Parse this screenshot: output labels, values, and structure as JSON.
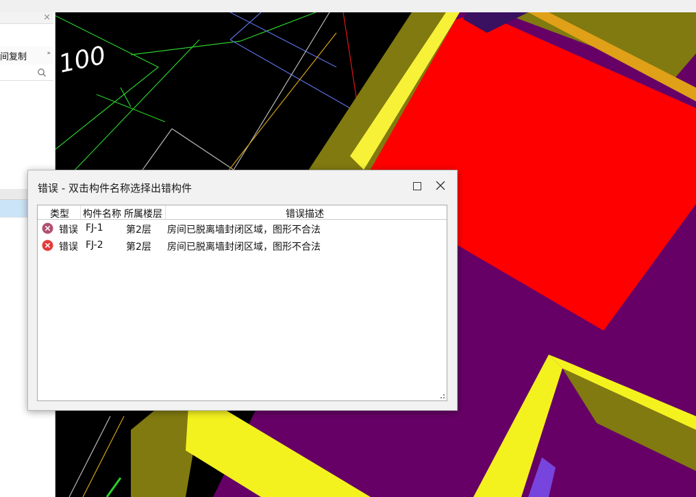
{
  "left_panel": {
    "toolbar_label": "间复制",
    "more_glyph": "»"
  },
  "dialog": {
    "title": "错误 - 双击构件名称选择出错构件",
    "columns": [
      "类型",
      "构件名称",
      "所属楼层",
      "错误描述"
    ],
    "rows": [
      {
        "type": "错误",
        "name": "FJ-1",
        "floor": "第2层",
        "desc": "房间已脱离墙封闭区域，图形不合法",
        "icon": "error-icon-muted"
      },
      {
        "type": "错误",
        "name": "FJ-2",
        "floor": "第2层",
        "desc": "房间已脱离墙封闭区域，图形不合法",
        "icon": "error-icon"
      }
    ]
  },
  "viewport": {
    "dimension_labels": [
      "100",
      "00"
    ],
    "colors": {
      "room_fill": "#ff0000",
      "floor_slab": "#660066",
      "wall_top": "#f3f21f",
      "wall_side": "#807a10",
      "canvas": "#000000"
    }
  },
  "colors": {
    "error_active": "#e43a3a",
    "error_muted": "#b05070",
    "selection": "#cce4f7"
  }
}
